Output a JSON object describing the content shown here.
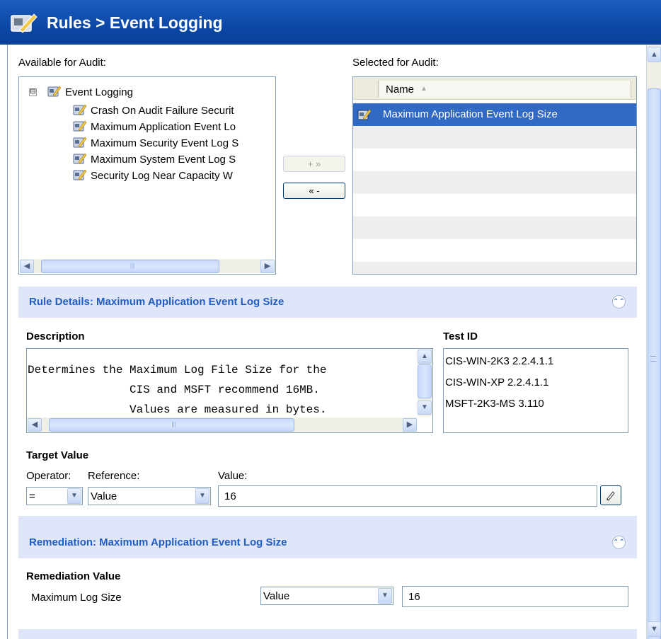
{
  "window": {
    "title": "Rules > Event Logging",
    "icon": "rules-edit-icon"
  },
  "available": {
    "label": "Available for Audit:",
    "tree": {
      "root": {
        "label": "Event Logging",
        "expander": "⊟"
      },
      "children": [
        "Crash On Audit Failure Securit",
        "Maximum Application Event Lo",
        "Maximum Security Event Log S",
        "Maximum System Event Log S",
        "Security Log Near Capacity W"
      ]
    }
  },
  "buttons": {
    "add": "+ »",
    "remove": "« -"
  },
  "selected": {
    "label": "Selected for Audit:",
    "column": "Name",
    "rows": [
      "Maximum Application Event Log Size"
    ]
  },
  "rule_details": {
    "title": "Rule Details: Maximum Application Event Log Size",
    "description_label": "Description",
    "description_lines": [
      "Determines the Maximum Log File Size for the",
      "               CIS and MSFT recommend 16MB.",
      "               Values are measured in bytes."
    ],
    "test_id_label": "Test ID",
    "test_ids": [
      "CIS-WIN-2K3 2.2.4.1.1",
      "CIS-WIN-XP 2.2.4.1.1",
      "MSFT-2K3-MS 3.110"
    ],
    "target_value_label": "Target Value",
    "operator_label": "Operator:",
    "reference_label": "Reference:",
    "value_label": "Value:",
    "operator": "=",
    "reference": "Value",
    "value": "16"
  },
  "remediation": {
    "title": "Remediation: Maximum Application Event Log Size",
    "value_label": "Remediation Value",
    "field_label": "Maximum Log Size",
    "reference": "Value",
    "value": "16"
  }
}
